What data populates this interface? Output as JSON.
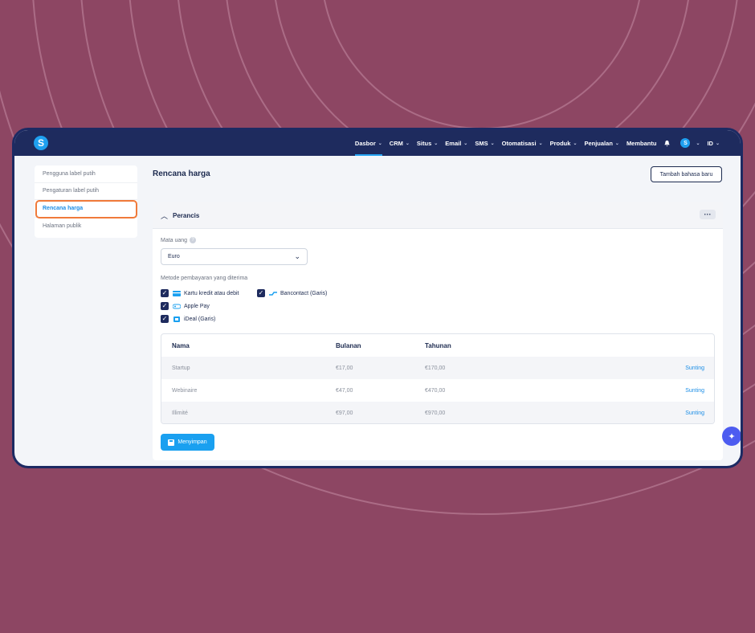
{
  "topbar": {
    "logo": "S",
    "nav": [
      {
        "label": "Dasbor",
        "active": true
      },
      {
        "label": "CRM"
      },
      {
        "label": "Situs"
      },
      {
        "label": "Email"
      },
      {
        "label": "SMS"
      },
      {
        "label": "Otomatisasi"
      },
      {
        "label": "Produk"
      },
      {
        "label": "Penjualan"
      },
      {
        "label": "Membantu"
      }
    ],
    "avatar": "S",
    "language": "ID"
  },
  "sidebar": {
    "items": [
      {
        "label": "Pengguna label putih"
      },
      {
        "label": "Pengaturan label putih"
      },
      {
        "label": "Rencana harga",
        "active": true
      },
      {
        "label": "Halaman publik"
      }
    ]
  },
  "page": {
    "title": "Rencana harga",
    "add_language_button": "Tambah bahasa baru"
  },
  "card": {
    "title": "Perancis",
    "currency_label": "Mata uang",
    "currency_value": "Euro",
    "payment_label": "Metode pembayaran yang diterima",
    "payment_methods": [
      {
        "label": "Kartu kredit atau debit",
        "checked": true
      },
      {
        "label": "Bancontact (Garis)",
        "checked": true
      },
      {
        "label": "Apple Pay",
        "checked": true
      },
      {
        "label": "iDeal (Garis)",
        "checked": true
      }
    ],
    "table": {
      "headers": [
        "Nama",
        "Bulanan",
        "Tahunan"
      ],
      "rows": [
        {
          "name": "Startup",
          "monthly": "€17,00",
          "yearly": "€170,00",
          "action": "Sunting"
        },
        {
          "name": "Webinaire",
          "monthly": "€47,00",
          "yearly": "€470,00",
          "action": "Sunting"
        },
        {
          "name": "Illimité",
          "monthly": "€97,00",
          "yearly": "€970,00",
          "action": "Sunting"
        }
      ]
    },
    "save_button": "Menyimpan"
  },
  "colors": {
    "background": "#8d4663",
    "topbar": "#1e2b5e",
    "accent": "#1aa0f0",
    "highlight": "#f07a3a"
  }
}
